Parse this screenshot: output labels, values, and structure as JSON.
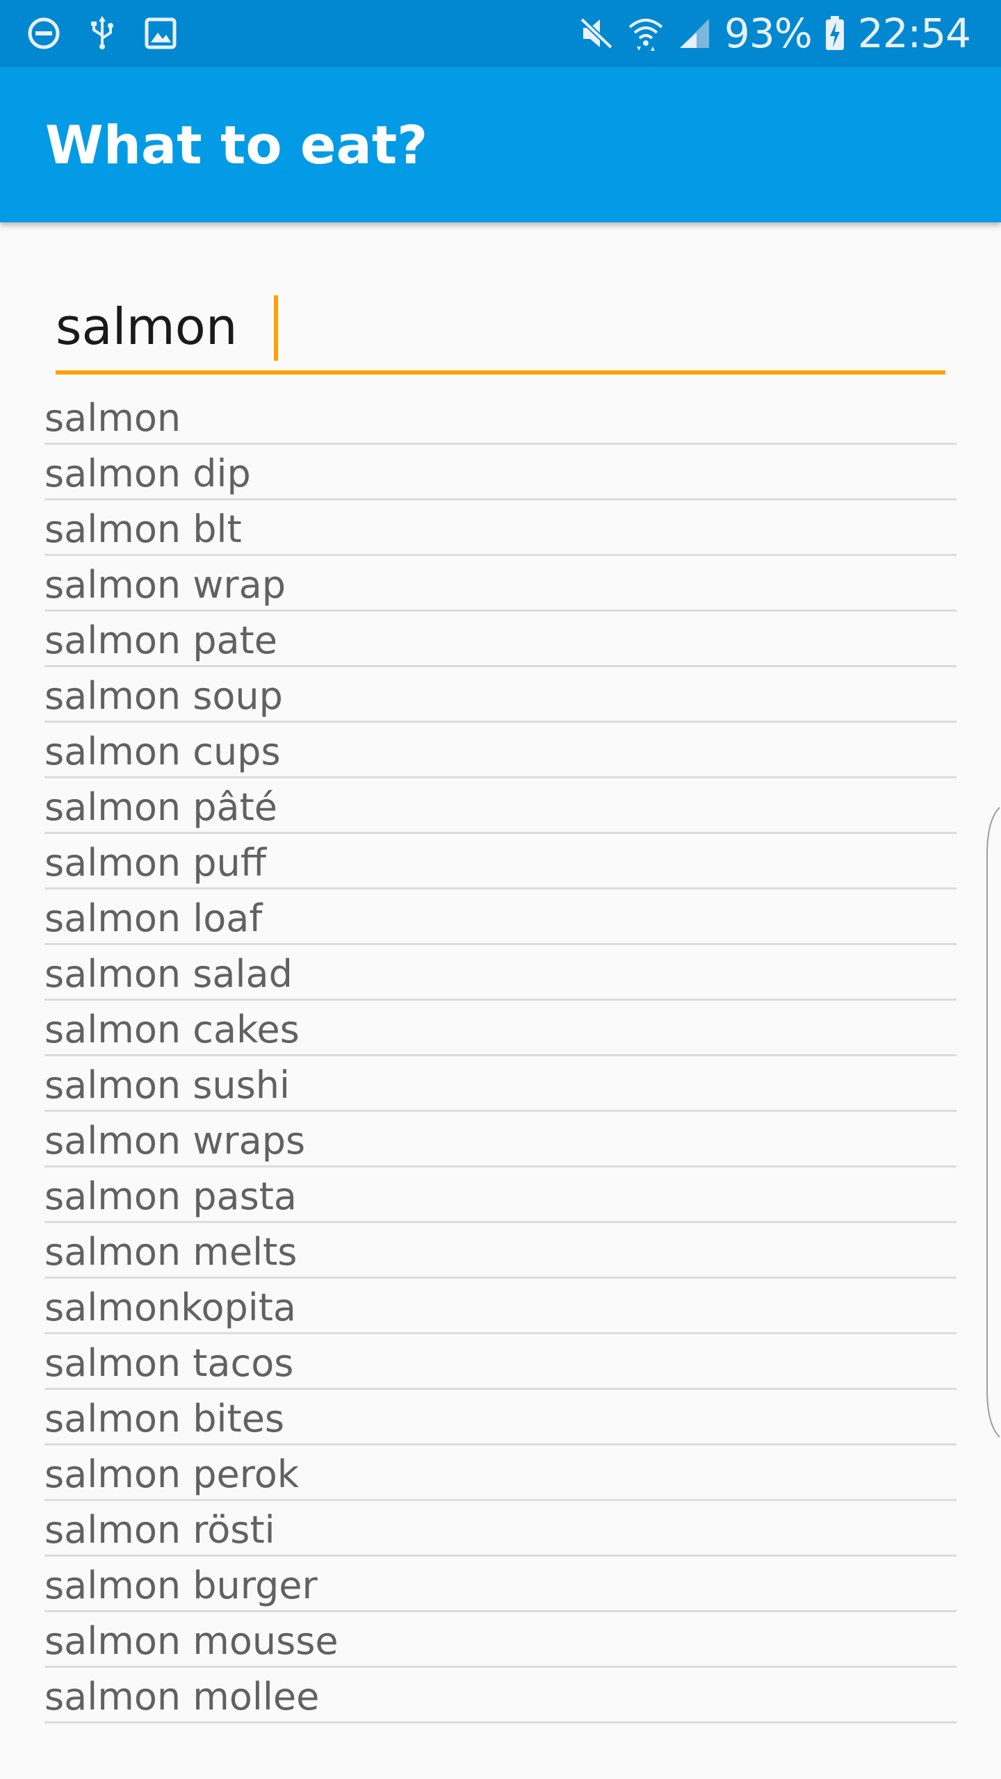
{
  "status_bar": {
    "left_icons": [
      "do-not-disturb-icon",
      "usb-icon",
      "image-icon"
    ],
    "right_icons": [
      "mute-icon",
      "wifi-icon",
      "signal-icon",
      "battery-charging-icon"
    ],
    "battery_percent": "93%",
    "time": "22:54"
  },
  "app_bar": {
    "title": "What to eat?"
  },
  "search": {
    "value": "salmon",
    "accent_color": "#ffa000"
  },
  "suggestions": [
    "salmon",
    "salmon dip",
    "salmon blt",
    "salmon wrap",
    "salmon pate",
    "salmon soup",
    "salmon cups",
    "salmon pâté",
    "salmon puff",
    "salmon loaf",
    "salmon salad",
    "salmon cakes",
    "salmon sushi",
    "salmon wraps",
    "salmon pasta",
    "salmon melts",
    "salmonkopita",
    "salmon tacos",
    "salmon bites",
    "salmon perok",
    "salmon rösti",
    "salmon burger",
    "salmon mousse",
    "salmon mollee"
  ],
  "colors": {
    "status_bar": "#0288d1",
    "app_bar": "#039be5",
    "background": "#fafafa",
    "suggestion_text": "#616161",
    "divider": "#dcdcdc"
  }
}
